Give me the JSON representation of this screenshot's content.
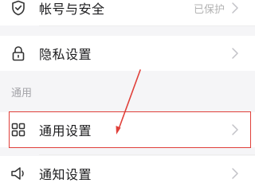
{
  "settings": {
    "account_security": {
      "label": "帐号与安全",
      "value": "已保护"
    },
    "privacy": {
      "label": "隐私设置"
    },
    "section_general": {
      "title": "通用"
    },
    "general": {
      "label": "通用设置"
    },
    "notifications": {
      "label": "通知设置"
    }
  },
  "icons": {
    "account_security": "shield-check-icon",
    "privacy": "lock-icon",
    "general": "grid-icon",
    "notifications": "speaker-icon",
    "row_arrow": "chevron-right-icon"
  },
  "colors": {
    "background": "#f5f5f7",
    "row_background": "#ffffff",
    "text_primary": "#1c1c1e",
    "text_secondary": "#b3b3b3",
    "section_title": "#a3a3a8",
    "annotation": "#e0403a"
  }
}
